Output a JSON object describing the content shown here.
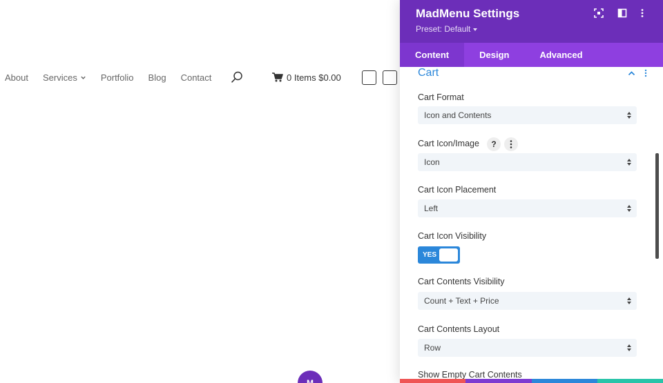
{
  "nav": {
    "items": [
      {
        "label": "About"
      },
      {
        "label": "Services"
      },
      {
        "label": "Portfolio"
      },
      {
        "label": "Blog"
      },
      {
        "label": "Contact"
      }
    ],
    "cart_label": "0 Items $0.00"
  },
  "fab": {
    "label": "M"
  },
  "modal": {
    "title": "MadMenu Settings",
    "preset": "Preset: Default",
    "tabs": [
      {
        "label": "Content"
      },
      {
        "label": "Design"
      },
      {
        "label": "Advanced"
      }
    ],
    "active_tab": "Content",
    "section": {
      "title": "Cart"
    },
    "fields": {
      "cart_format": {
        "label": "Cart Format",
        "value": "Icon and Contents"
      },
      "cart_icon_image": {
        "label": "Cart Icon/Image",
        "value": "Icon",
        "help": "?"
      },
      "cart_icon_placement": {
        "label": "Cart Icon Placement",
        "value": "Left"
      },
      "cart_icon_visibility": {
        "label": "Cart Icon Visibility",
        "toggle_text": "YES",
        "on": true
      },
      "cart_contents_visibility": {
        "label": "Cart Contents Visibility",
        "value": "Count + Text + Price"
      },
      "cart_contents_layout": {
        "label": "Cart Contents Layout",
        "value": "Row"
      },
      "show_empty_cart_contents": {
        "label": "Show Empty Cart Contents"
      }
    }
  },
  "colors": {
    "header": "#6c2eb9",
    "tabs": "#8e3fe0",
    "accent": "#2b87da",
    "footer": [
      "#ef5555",
      "#7d3bd1",
      "#2b87da",
      "#29c4a9"
    ]
  }
}
